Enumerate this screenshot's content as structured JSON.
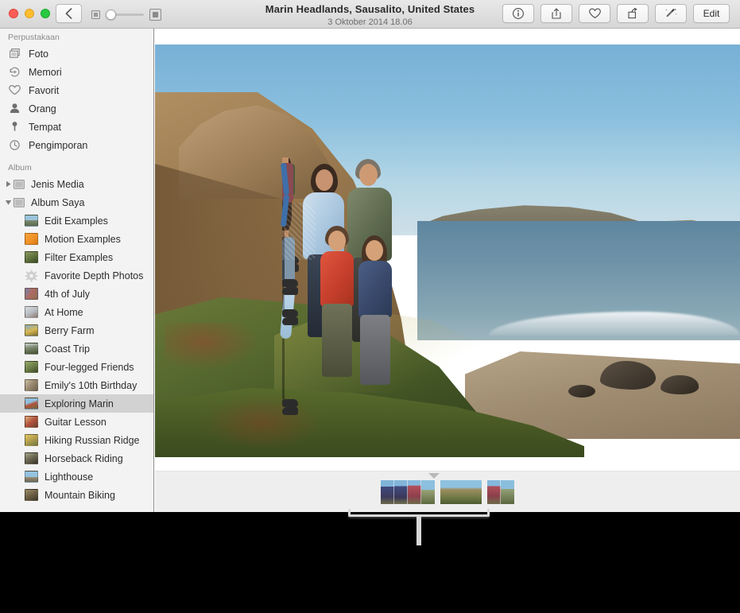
{
  "window": {
    "title": "Marin Headlands, Sausalito, United States",
    "subtitle": "3 Oktober 2014 18.06"
  },
  "titlebar": {
    "back_icon": "chevron-left-icon",
    "zoom_slider": {
      "small_icon": "small-thumbnail-icon",
      "large_icon": "large-thumbnail-icon",
      "value": 0
    },
    "tools": [
      {
        "name": "info-button",
        "icon": "info-circle-icon",
        "label": ""
      },
      {
        "name": "share-button",
        "icon": "share-box-icon",
        "label": ""
      },
      {
        "name": "favorite-button",
        "icon": "heart-icon",
        "label": ""
      },
      {
        "name": "rotate-button",
        "icon": "rotate-icon",
        "label": ""
      },
      {
        "name": "enhance-button",
        "icon": "magic-wand-icon",
        "label": ""
      },
      {
        "name": "edit-button",
        "icon": "",
        "label": "Edit"
      }
    ]
  },
  "sidebar": {
    "library_header": "Perpustakaan",
    "library_items": [
      {
        "label": "Foto",
        "icon": "photos-stack-icon"
      },
      {
        "label": "Memori",
        "icon": "memories-clock-play-icon"
      },
      {
        "label": "Favorit",
        "icon": "heart-icon"
      },
      {
        "label": "Orang",
        "icon": "person-icon"
      },
      {
        "label": "Tempat",
        "icon": "map-pin-icon"
      },
      {
        "label": "Pengimporan",
        "icon": "clock-icon"
      }
    ],
    "album_header": "Album",
    "groups": [
      {
        "label": "Jenis Media",
        "expanded": false,
        "icon": "folder-icon"
      },
      {
        "label": "Album Saya",
        "expanded": true,
        "icon": "folder-icon"
      }
    ],
    "albums": [
      {
        "label": "Edit Examples",
        "icon": "album-thumbnail",
        "selected": false
      },
      {
        "label": "Motion Examples",
        "icon": "album-thumbnail",
        "selected": false
      },
      {
        "label": "Filter Examples",
        "icon": "album-thumbnail",
        "selected": false
      },
      {
        "label": "Favorite Depth Photos",
        "icon": "gear-icon",
        "selected": false
      },
      {
        "label": "4th of July",
        "icon": "album-thumbnail",
        "selected": false
      },
      {
        "label": "At Home",
        "icon": "album-thumbnail",
        "selected": false
      },
      {
        "label": "Berry Farm",
        "icon": "album-thumbnail",
        "selected": false
      },
      {
        "label": "Coast Trip",
        "icon": "album-thumbnail",
        "selected": false
      },
      {
        "label": "Four-legged Friends",
        "icon": "album-thumbnail",
        "selected": false
      },
      {
        "label": "Emily's 10th Birthday",
        "icon": "album-thumbnail",
        "selected": false
      },
      {
        "label": "Exploring Marin",
        "icon": "album-thumbnail",
        "selected": true
      },
      {
        "label": "Guitar Lesson",
        "icon": "album-thumbnail",
        "selected": false
      },
      {
        "label": "Hiking Russian Ridge",
        "icon": "album-thumbnail",
        "selected": false
      },
      {
        "label": "Horseback Riding",
        "icon": "album-thumbnail",
        "selected": false
      },
      {
        "label": "Lighthouse",
        "icon": "album-thumbnail",
        "selected": false
      },
      {
        "label": "Mountain Biking",
        "icon": "album-thumbnail",
        "selected": false
      }
    ]
  },
  "main": {
    "photo_alt": "Family of four standing on a coastal hillside at Marin Headlands with ocean and beach behind",
    "filmstrip": {
      "marker_icon": "caret-down-icon",
      "groups": [
        {
          "count": 4
        },
        {
          "count": 1
        },
        {
          "count": 2
        }
      ]
    }
  },
  "annotation": {
    "callout_shape": "bracket-pointer",
    "color": "#d8d8d8",
    "target": "filmstrip"
  },
  "colors": {
    "titlebar_top": "#e8e8e8",
    "titlebar_bottom": "#d6d6d6",
    "sidebar_bg": "#f3f3f3",
    "selection": "#d2d2d2",
    "filmstrip_bg": "#eeeeee",
    "backdrop": "#000000",
    "traffic_red": "#ff5f57",
    "traffic_yellow": "#ffbd2e",
    "traffic_green": "#28c940"
  }
}
